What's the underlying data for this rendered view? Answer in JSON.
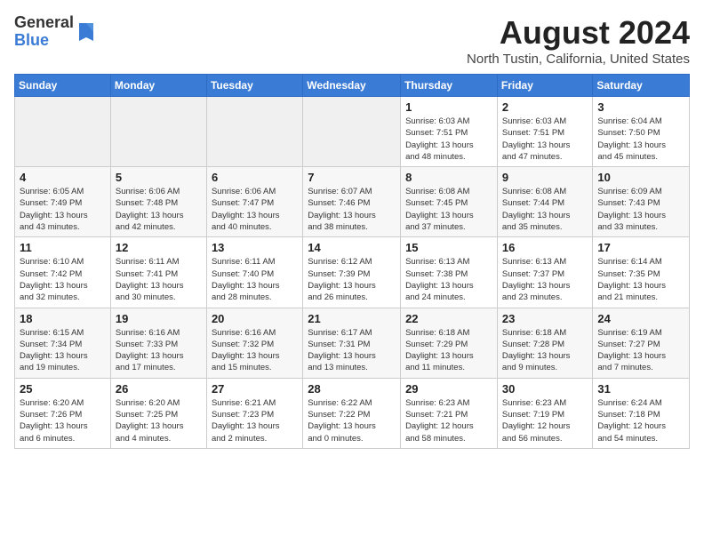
{
  "header": {
    "logo_general": "General",
    "logo_blue": "Blue",
    "month_year": "August 2024",
    "location": "North Tustin, California, United States"
  },
  "weekdays": [
    "Sunday",
    "Monday",
    "Tuesday",
    "Wednesday",
    "Thursday",
    "Friday",
    "Saturday"
  ],
  "weeks": [
    [
      {
        "day": "",
        "info": ""
      },
      {
        "day": "",
        "info": ""
      },
      {
        "day": "",
        "info": ""
      },
      {
        "day": "",
        "info": ""
      },
      {
        "day": "1",
        "info": "Sunrise: 6:03 AM\nSunset: 7:51 PM\nDaylight: 13 hours\nand 48 minutes."
      },
      {
        "day": "2",
        "info": "Sunrise: 6:03 AM\nSunset: 7:51 PM\nDaylight: 13 hours\nand 47 minutes."
      },
      {
        "day": "3",
        "info": "Sunrise: 6:04 AM\nSunset: 7:50 PM\nDaylight: 13 hours\nand 45 minutes."
      }
    ],
    [
      {
        "day": "4",
        "info": "Sunrise: 6:05 AM\nSunset: 7:49 PM\nDaylight: 13 hours\nand 43 minutes."
      },
      {
        "day": "5",
        "info": "Sunrise: 6:06 AM\nSunset: 7:48 PM\nDaylight: 13 hours\nand 42 minutes."
      },
      {
        "day": "6",
        "info": "Sunrise: 6:06 AM\nSunset: 7:47 PM\nDaylight: 13 hours\nand 40 minutes."
      },
      {
        "day": "7",
        "info": "Sunrise: 6:07 AM\nSunset: 7:46 PM\nDaylight: 13 hours\nand 38 minutes."
      },
      {
        "day": "8",
        "info": "Sunrise: 6:08 AM\nSunset: 7:45 PM\nDaylight: 13 hours\nand 37 minutes."
      },
      {
        "day": "9",
        "info": "Sunrise: 6:08 AM\nSunset: 7:44 PM\nDaylight: 13 hours\nand 35 minutes."
      },
      {
        "day": "10",
        "info": "Sunrise: 6:09 AM\nSunset: 7:43 PM\nDaylight: 13 hours\nand 33 minutes."
      }
    ],
    [
      {
        "day": "11",
        "info": "Sunrise: 6:10 AM\nSunset: 7:42 PM\nDaylight: 13 hours\nand 32 minutes."
      },
      {
        "day": "12",
        "info": "Sunrise: 6:11 AM\nSunset: 7:41 PM\nDaylight: 13 hours\nand 30 minutes."
      },
      {
        "day": "13",
        "info": "Sunrise: 6:11 AM\nSunset: 7:40 PM\nDaylight: 13 hours\nand 28 minutes."
      },
      {
        "day": "14",
        "info": "Sunrise: 6:12 AM\nSunset: 7:39 PM\nDaylight: 13 hours\nand 26 minutes."
      },
      {
        "day": "15",
        "info": "Sunrise: 6:13 AM\nSunset: 7:38 PM\nDaylight: 13 hours\nand 24 minutes."
      },
      {
        "day": "16",
        "info": "Sunrise: 6:13 AM\nSunset: 7:37 PM\nDaylight: 13 hours\nand 23 minutes."
      },
      {
        "day": "17",
        "info": "Sunrise: 6:14 AM\nSunset: 7:35 PM\nDaylight: 13 hours\nand 21 minutes."
      }
    ],
    [
      {
        "day": "18",
        "info": "Sunrise: 6:15 AM\nSunset: 7:34 PM\nDaylight: 13 hours\nand 19 minutes."
      },
      {
        "day": "19",
        "info": "Sunrise: 6:16 AM\nSunset: 7:33 PM\nDaylight: 13 hours\nand 17 minutes."
      },
      {
        "day": "20",
        "info": "Sunrise: 6:16 AM\nSunset: 7:32 PM\nDaylight: 13 hours\nand 15 minutes."
      },
      {
        "day": "21",
        "info": "Sunrise: 6:17 AM\nSunset: 7:31 PM\nDaylight: 13 hours\nand 13 minutes."
      },
      {
        "day": "22",
        "info": "Sunrise: 6:18 AM\nSunset: 7:29 PM\nDaylight: 13 hours\nand 11 minutes."
      },
      {
        "day": "23",
        "info": "Sunrise: 6:18 AM\nSunset: 7:28 PM\nDaylight: 13 hours\nand 9 minutes."
      },
      {
        "day": "24",
        "info": "Sunrise: 6:19 AM\nSunset: 7:27 PM\nDaylight: 13 hours\nand 7 minutes."
      }
    ],
    [
      {
        "day": "25",
        "info": "Sunrise: 6:20 AM\nSunset: 7:26 PM\nDaylight: 13 hours\nand 6 minutes."
      },
      {
        "day": "26",
        "info": "Sunrise: 6:20 AM\nSunset: 7:25 PM\nDaylight: 13 hours\nand 4 minutes."
      },
      {
        "day": "27",
        "info": "Sunrise: 6:21 AM\nSunset: 7:23 PM\nDaylight: 13 hours\nand 2 minutes."
      },
      {
        "day": "28",
        "info": "Sunrise: 6:22 AM\nSunset: 7:22 PM\nDaylight: 13 hours\nand 0 minutes."
      },
      {
        "day": "29",
        "info": "Sunrise: 6:23 AM\nSunset: 7:21 PM\nDaylight: 12 hours\nand 58 minutes."
      },
      {
        "day": "30",
        "info": "Sunrise: 6:23 AM\nSunset: 7:19 PM\nDaylight: 12 hours\nand 56 minutes."
      },
      {
        "day": "31",
        "info": "Sunrise: 6:24 AM\nSunset: 7:18 PM\nDaylight: 12 hours\nand 54 minutes."
      }
    ]
  ]
}
